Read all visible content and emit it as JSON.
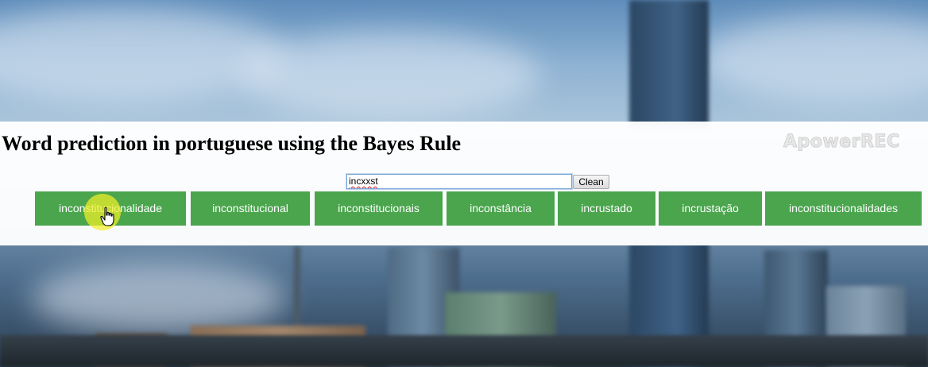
{
  "page": {
    "title": "Word prediction in portuguese using the Bayes Rule",
    "watermark": "ApowerREC"
  },
  "search": {
    "value": "incxxst"
  },
  "clean_button": {
    "label": "Clean"
  },
  "suggestions": [
    {
      "label": "inconstitucionalidade"
    },
    {
      "label": "inconstitucional"
    },
    {
      "label": "inconstitucionais"
    },
    {
      "label": "inconstância"
    },
    {
      "label": "incrustado"
    },
    {
      "label": "incrustação"
    },
    {
      "label": "inconstitucionalidades"
    }
  ],
  "colors": {
    "suggestion_bg": "#4aa54d",
    "suggestion_text": "#ffffff",
    "cursor_halo": "#f0f028"
  },
  "icons": {
    "cursor": "hand-pointer-icon"
  }
}
